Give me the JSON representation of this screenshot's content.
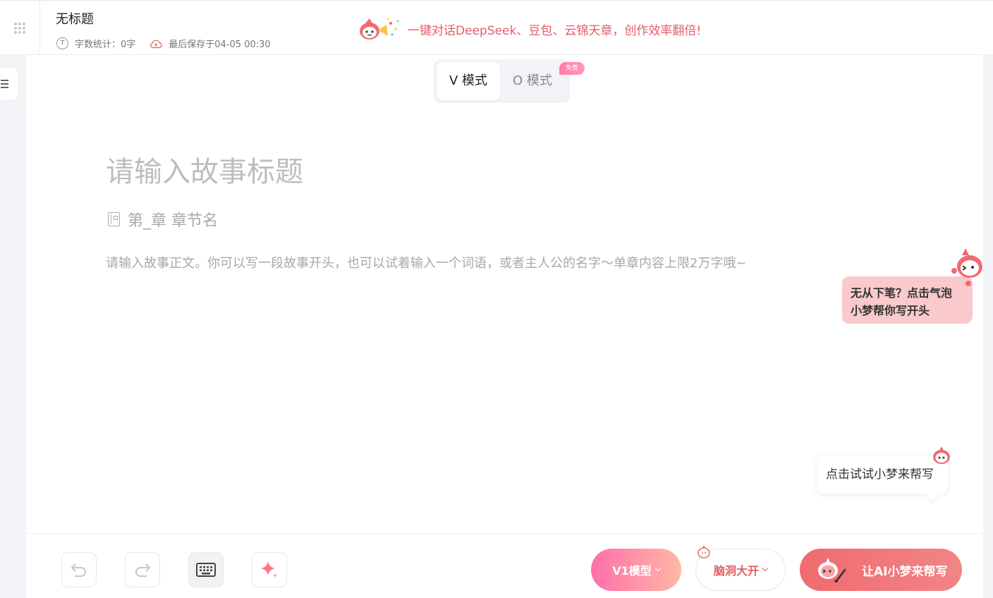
{
  "header": {
    "doc_title": "无标题",
    "word_count": "字数统计：0字",
    "saved_at": "最后保存于04-05 00:30",
    "word_icon_letter": "T",
    "promo": "一键对话DeepSeek、豆包、云锦天章，创作效率翻倍!"
  },
  "modes": {
    "tabs": [
      {
        "label": "V 模式",
        "active": true
      },
      {
        "label": "O 模式",
        "active": false
      }
    ],
    "badge": "免费"
  },
  "editor": {
    "title_placeholder": "请输入故事标题",
    "chapter_placeholder": "第_章 章节名",
    "body_placeholder": "请输入故事正文。你可以写一段故事开头，也可以试着输入一个词语，或者主人公的名字～单章内容上限2万字哦~"
  },
  "hints": {
    "bubble_line1": "无从下笔？点击气泡",
    "bubble_line2": "小梦帮你写开头",
    "try_text": "点击试试小梦来帮写"
  },
  "toolbar": {
    "model_label": "V1模型",
    "brain_label": "脑洞大开",
    "ai_label": "让AI小梦来帮写"
  },
  "colors": {
    "accent_red": "#e55b6a",
    "pink_bubble": "#f9c9cb",
    "ai_button": "#f06b70"
  },
  "icons": [
    "grip-icon",
    "word-count-icon",
    "cloud-save-icon",
    "mascot-icon",
    "menu-icon",
    "book-icon",
    "undo-icon",
    "redo-icon",
    "keyboard-icon",
    "sparkle-icon",
    "chevron-down-icon",
    "brush-icon"
  ]
}
